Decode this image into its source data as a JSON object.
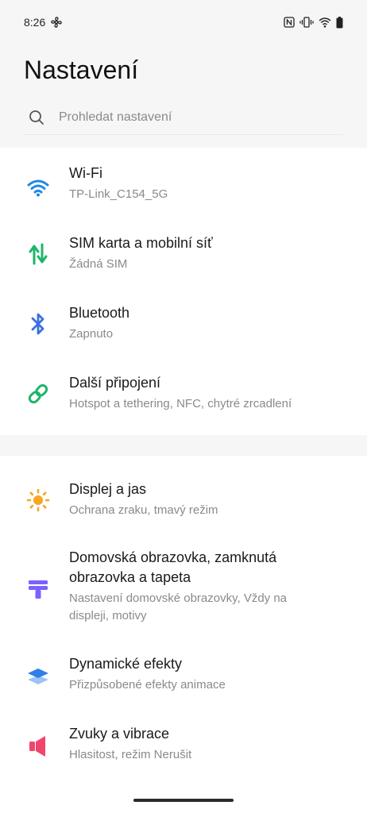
{
  "status_bar": {
    "time": "8:26",
    "icons": [
      "fan-icon",
      "nfc-icon",
      "vibrate-icon",
      "wifi-icon",
      "battery-icon"
    ]
  },
  "header": {
    "title": "Nastavení"
  },
  "search": {
    "placeholder": "Prohledat nastavení"
  },
  "sections": [
    {
      "items": [
        {
          "icon": "wifi-icon",
          "title": "Wi-Fi",
          "subtitle": "TP-Link_C154_5G",
          "color": "#1e88e5"
        },
        {
          "icon": "mobile-data-icon",
          "title": "SIM karta a mobilní síť",
          "subtitle": "Žádná SIM",
          "color": "#1db66a"
        },
        {
          "icon": "bluetooth-icon",
          "title": "Bluetooth",
          "subtitle": "Zapnuto",
          "color": "#3d6fe0"
        },
        {
          "icon": "link-icon",
          "title": "Další připojení",
          "subtitle": "Hotspot a tethering, NFC, chytré zrcadlení",
          "color": "#1db66a"
        }
      ]
    },
    {
      "items": [
        {
          "icon": "brightness-icon",
          "title": "Displej a jas",
          "subtitle": "Ochrana zraku, tmavý režim",
          "color": "#f5a623"
        },
        {
          "icon": "wallpaper-icon",
          "title_line1": "Domovská obrazovka, zamknutá",
          "title_line2": "obrazovka a tapeta",
          "subtitle_line1": "Nastavení domovské obrazovky, Vždy na",
          "subtitle_line2": "displeji, motivy",
          "color": "#7b61ff"
        },
        {
          "icon": "layers-icon",
          "title": "Dynamické efekty",
          "subtitle": "Přizpůsobené efekty animace",
          "color": "#2f7fe8"
        },
        {
          "icon": "speaker-icon",
          "title": "Zvuky a vibrace",
          "subtitle": "Hlasitost, režim Nerušit",
          "color": "#f0466b"
        }
      ]
    }
  ]
}
